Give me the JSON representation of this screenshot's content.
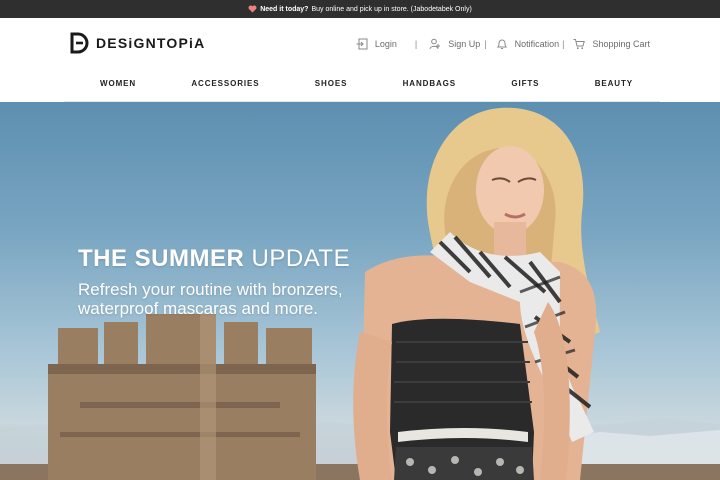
{
  "promo": {
    "icon": "heart-icon",
    "bold_text": "Need it today?",
    "text": "Buy online and pick up in store. (Jabodetabek Only)"
  },
  "brand": {
    "name": "DESiGNTOPiA",
    "logo_icon": "designtopia-logo-icon"
  },
  "utility": {
    "login": "Login",
    "signup": "Sign Up",
    "notification": "Notification",
    "cart": "Shopping Cart",
    "separator": "|"
  },
  "nav": {
    "items": [
      "WOMEN",
      "ACCESSORIES",
      "SHOES",
      "HANDBAGS",
      "GIFTS",
      "BEAUTY"
    ]
  },
  "hero": {
    "title_bold": "THE SUMMER",
    "title_light": "UPDATE",
    "subtitle": "Refresh your routine with bronzers, waterproof mascaras and more."
  },
  "colors": {
    "promo_bg": "#2f2f2f",
    "heart": "#f08080",
    "sky_top": "#5d8fb0",
    "text_dark": "#222222"
  }
}
